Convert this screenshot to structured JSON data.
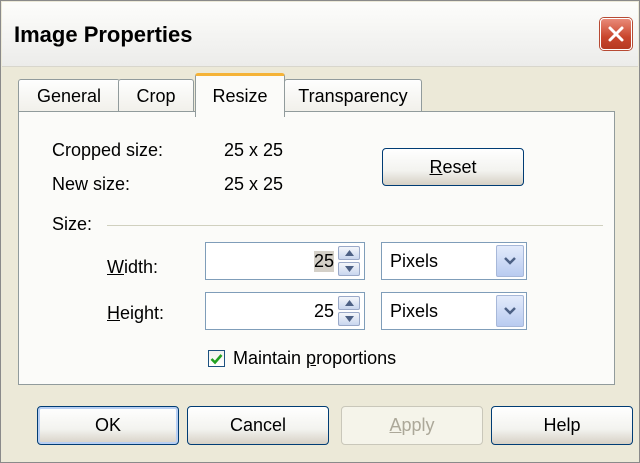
{
  "window": {
    "title": "Image Properties"
  },
  "tabs": [
    {
      "label": "General"
    },
    {
      "label": "Crop"
    },
    {
      "label": "Resize"
    },
    {
      "label": "Transparency"
    }
  ],
  "resize": {
    "cropped_size_label": "Cropped size:",
    "cropped_size_value": "25 x 25",
    "new_size_label": "New size:",
    "new_size_value": "25 x 25",
    "reset_prefix": "R",
    "reset_rest": "eset",
    "size_label": "Size:",
    "width_prefix": "W",
    "width_rest": "idth:",
    "width_value": "25",
    "width_unit": "Pixels",
    "height_prefix": "H",
    "height_rest": "eight:",
    "height_value": "25",
    "height_unit": "Pixels",
    "maintain_before": "Maintain ",
    "maintain_underlined": "p",
    "maintain_after": "roportions",
    "maintain_checked": true
  },
  "buttons": {
    "ok": "OK",
    "cancel": "Cancel",
    "apply_prefix": "A",
    "apply_rest": "pply",
    "help": "Help"
  },
  "colors": {
    "tab_accent": "#f5b337",
    "close_button": "#c9462d",
    "check_mark": "#21a121"
  }
}
